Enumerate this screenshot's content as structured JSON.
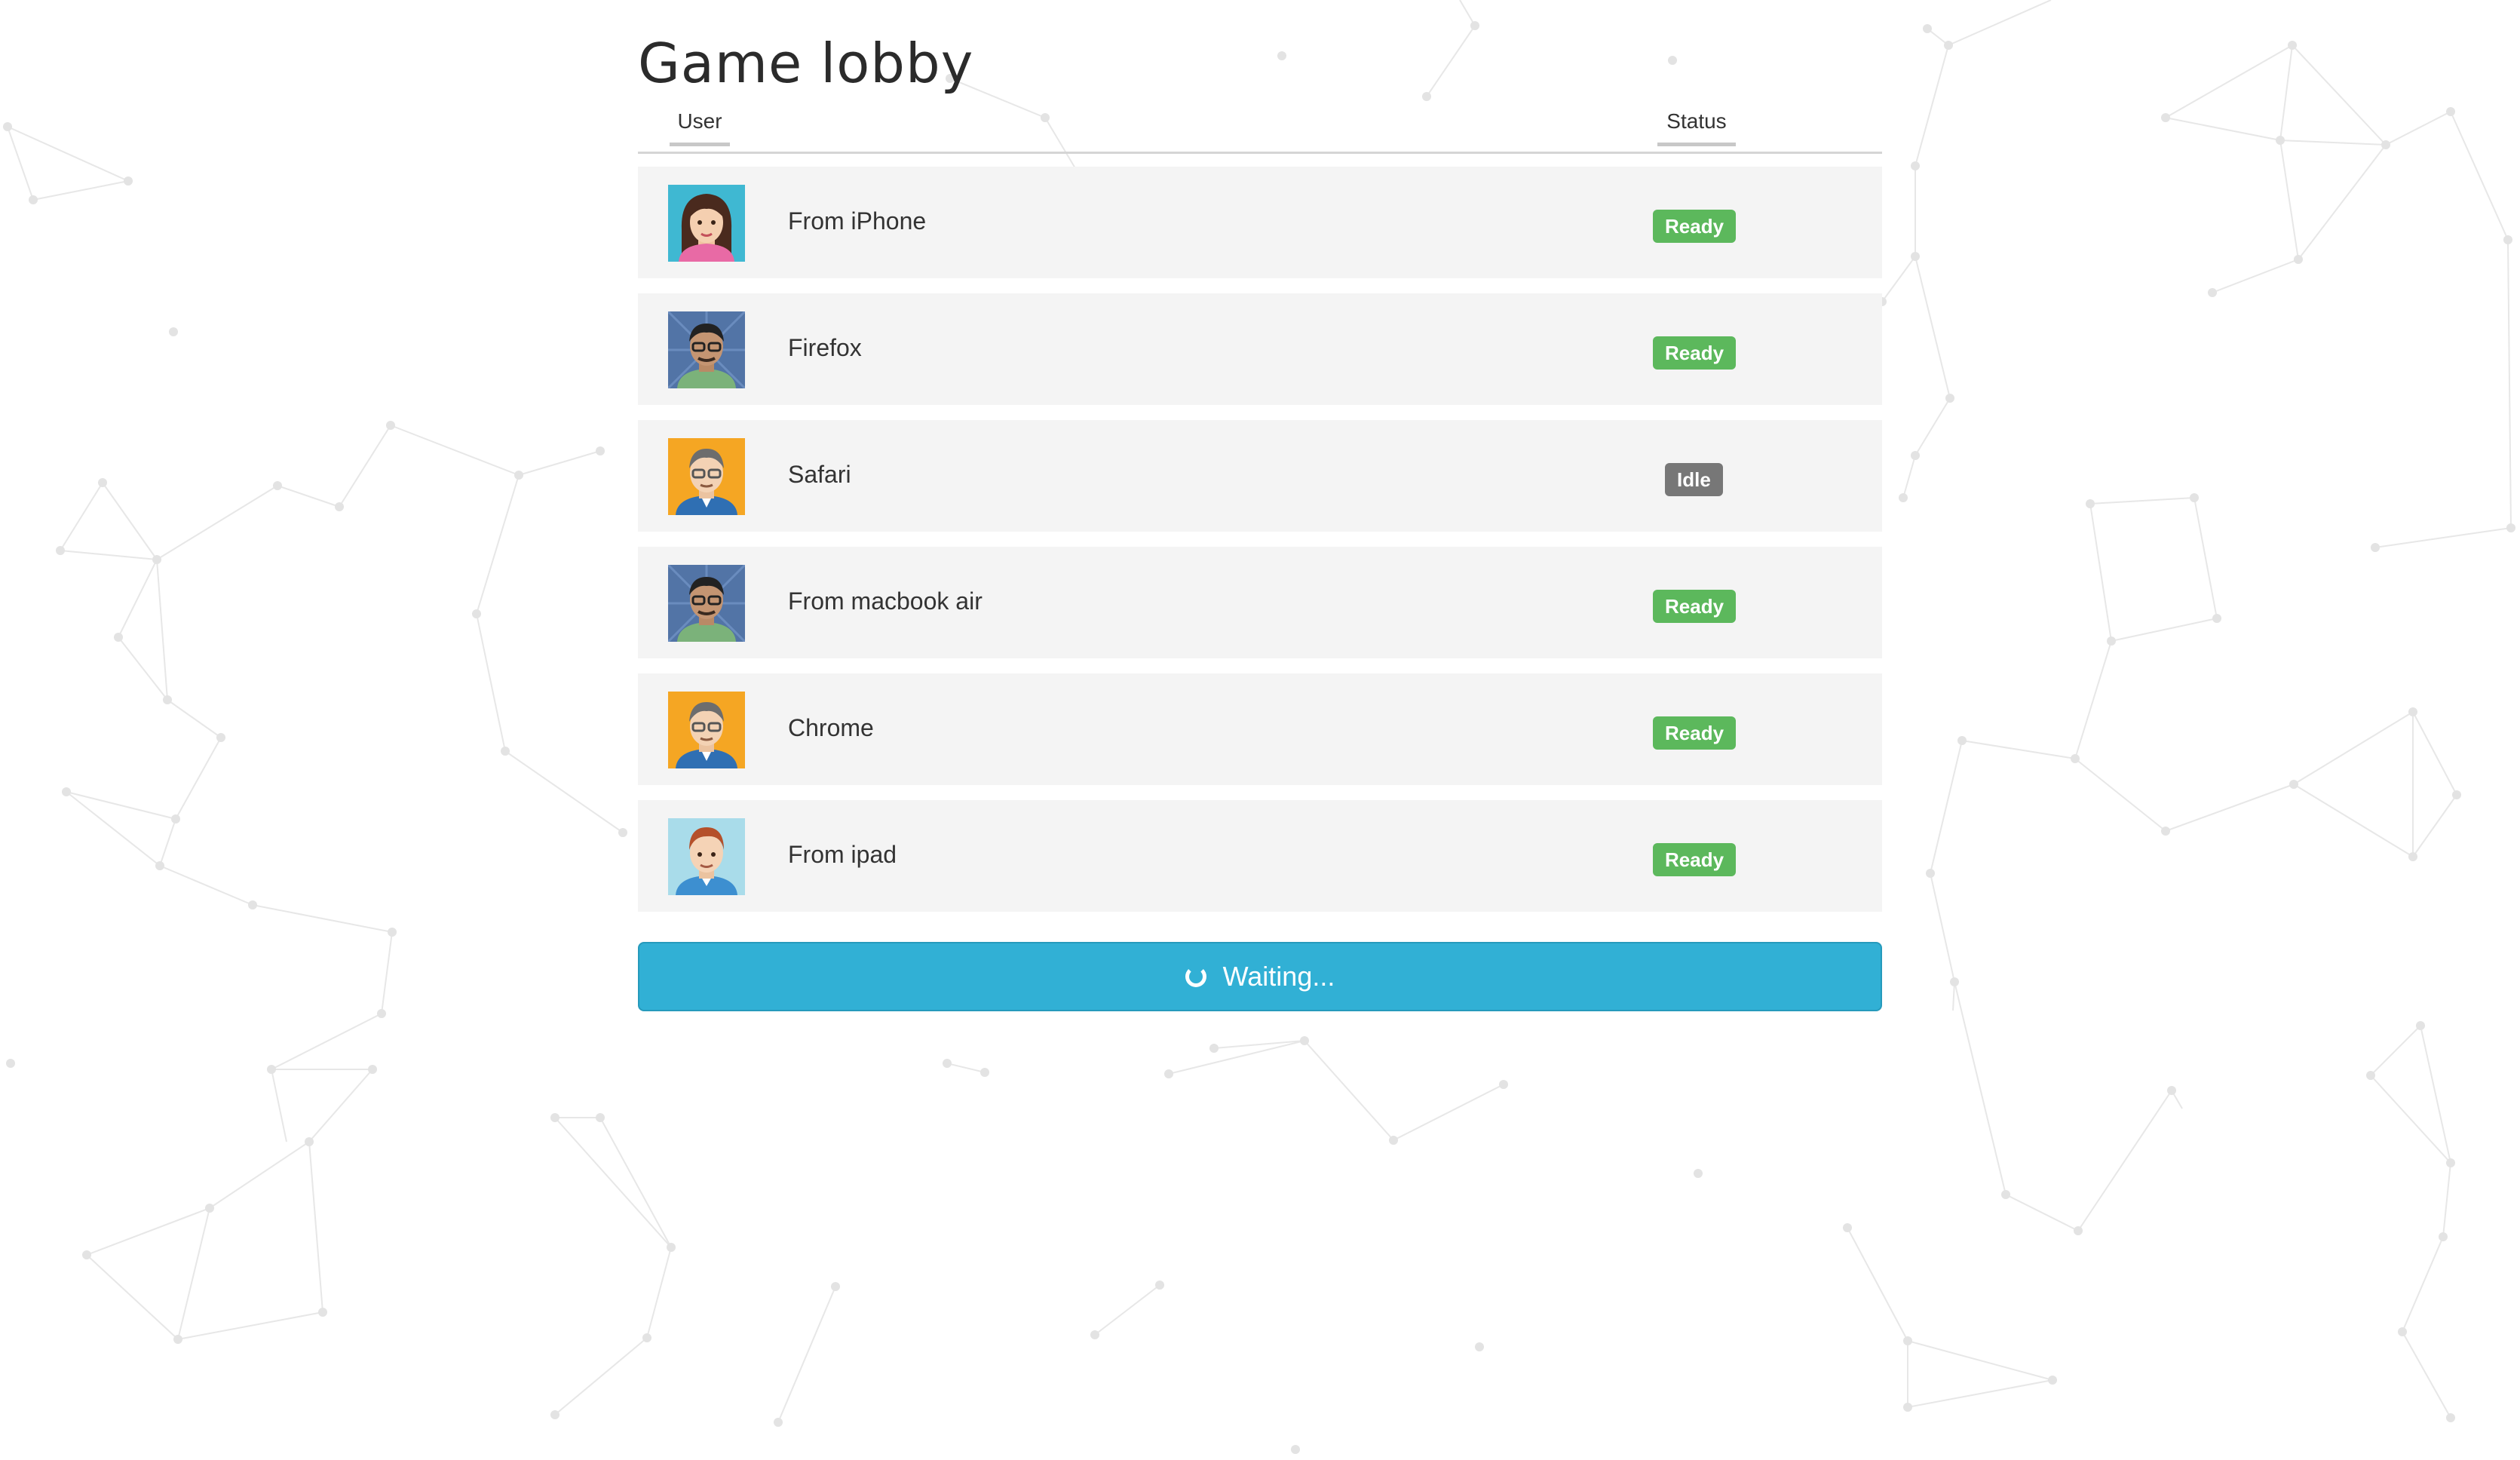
{
  "page": {
    "title": "Game lobby"
  },
  "table": {
    "headers": {
      "user": "User",
      "status": "Status"
    },
    "rows": [
      {
        "name": "From iPhone",
        "status": "Ready",
        "avatar": "woman-avatar-icon"
      },
      {
        "name": "Firefox",
        "status": "Ready",
        "avatar": "man-dark-glasses-avatar-icon"
      },
      {
        "name": "Safari",
        "status": "Idle",
        "avatar": "man-glasses-avatar-icon"
      },
      {
        "name": "From macbook air",
        "status": "Ready",
        "avatar": "man-dark-glasses-avatar-icon"
      },
      {
        "name": "Chrome",
        "status": "Ready",
        "avatar": "man-glasses-avatar-icon"
      },
      {
        "name": "From ipad",
        "status": "Ready",
        "avatar": "man-red-hair-avatar-icon"
      }
    ]
  },
  "action": {
    "label": "Waiting...",
    "icon": "spinner-icon"
  },
  "colors": {
    "ready": "#5cb85c",
    "idle": "#777777",
    "button": "#31b0d5",
    "row": "#f4f4f4"
  }
}
